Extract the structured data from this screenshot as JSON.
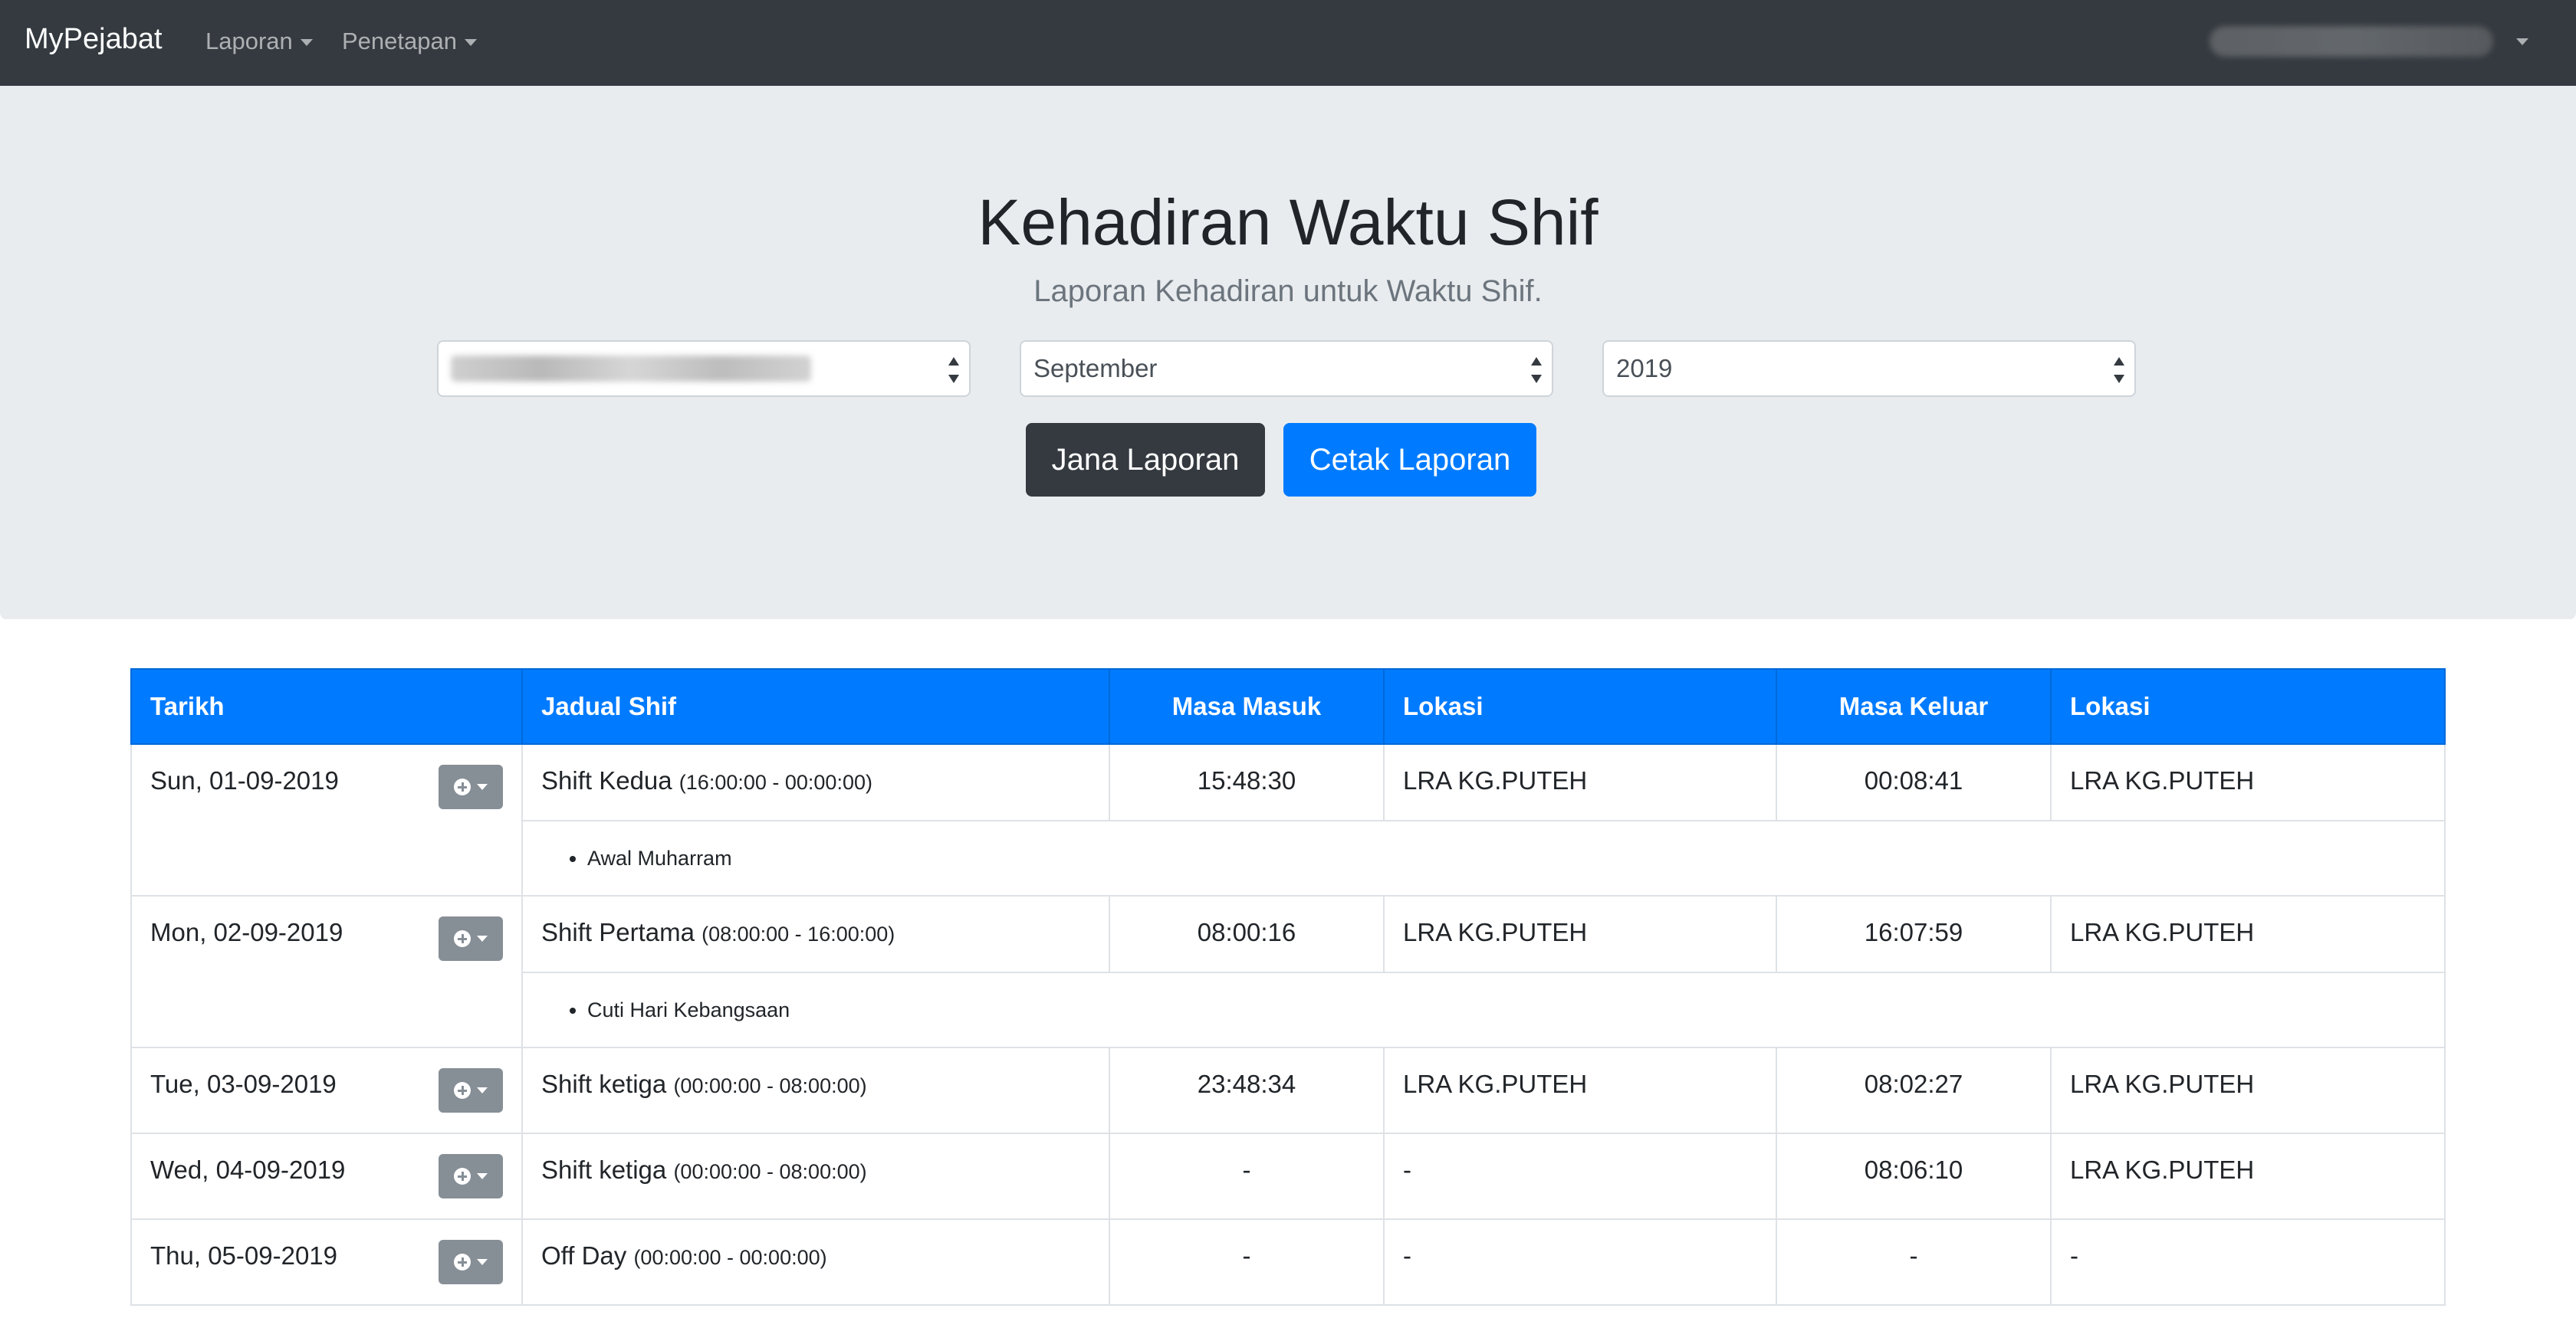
{
  "navbar": {
    "brand": "MyPejabat",
    "menu_laporan": "Laporan",
    "menu_penetapan": "Penetapan"
  },
  "header": {
    "title": "Kehadiran Waktu Shif",
    "subtitle": "Laporan Kehadiran untuk Waktu Shif."
  },
  "filters": {
    "month": "September",
    "year": "2019"
  },
  "buttons": {
    "generate": "Jana Laporan",
    "print": "Cetak Laporan"
  },
  "table": {
    "columns": [
      "Tarikh",
      "Jadual Shif",
      "Masa Masuk",
      "Lokasi",
      "Masa Keluar",
      "Lokasi"
    ],
    "rows": [
      {
        "date": "Sun, 01-09-2019",
        "shift": "Shift Kedua",
        "shift_time": "(16:00:00 - 00:00:00)",
        "in": "15:48:30",
        "in_loc": "LRA KG.PUTEH",
        "out": "00:08:41",
        "out_loc": "LRA KG.PUTEH",
        "note": "Awal Muharram"
      },
      {
        "date": "Mon, 02-09-2019",
        "shift": "Shift Pertama",
        "shift_time": "(08:00:00 - 16:00:00)",
        "in": "08:00:16",
        "in_loc": "LRA KG.PUTEH",
        "out": "16:07:59",
        "out_loc": "LRA KG.PUTEH",
        "note": "Cuti Hari Kebangsaan"
      },
      {
        "date": "Tue, 03-09-2019",
        "shift": "Shift ketiga",
        "shift_time": "(00:00:00 - 08:00:00)",
        "in": "23:48:34",
        "in_loc": "LRA KG.PUTEH",
        "out": "08:02:27",
        "out_loc": "LRA KG.PUTEH"
      },
      {
        "date": "Wed, 04-09-2019",
        "shift": "Shift ketiga",
        "shift_time": "(00:00:00 - 08:00:00)",
        "in": "-",
        "in_loc": "-",
        "out": "08:06:10",
        "out_loc": "LRA KG.PUTEH"
      },
      {
        "date": "Thu, 05-09-2019",
        "shift": "Off Day",
        "shift_time": "(00:00:00 - 00:00:00)",
        "in": "-",
        "in_loc": "-",
        "out": "-",
        "out_loc": "-"
      }
    ]
  },
  "colors": {
    "navbar": "#343a40",
    "jumbotron": "#e9ecef",
    "primary": "#007bff",
    "dark_button": "#343a40",
    "action_button": "#868e96"
  },
  "icons": {
    "action": "plus-circle-icon",
    "dropdown": "caret-down-icon"
  }
}
